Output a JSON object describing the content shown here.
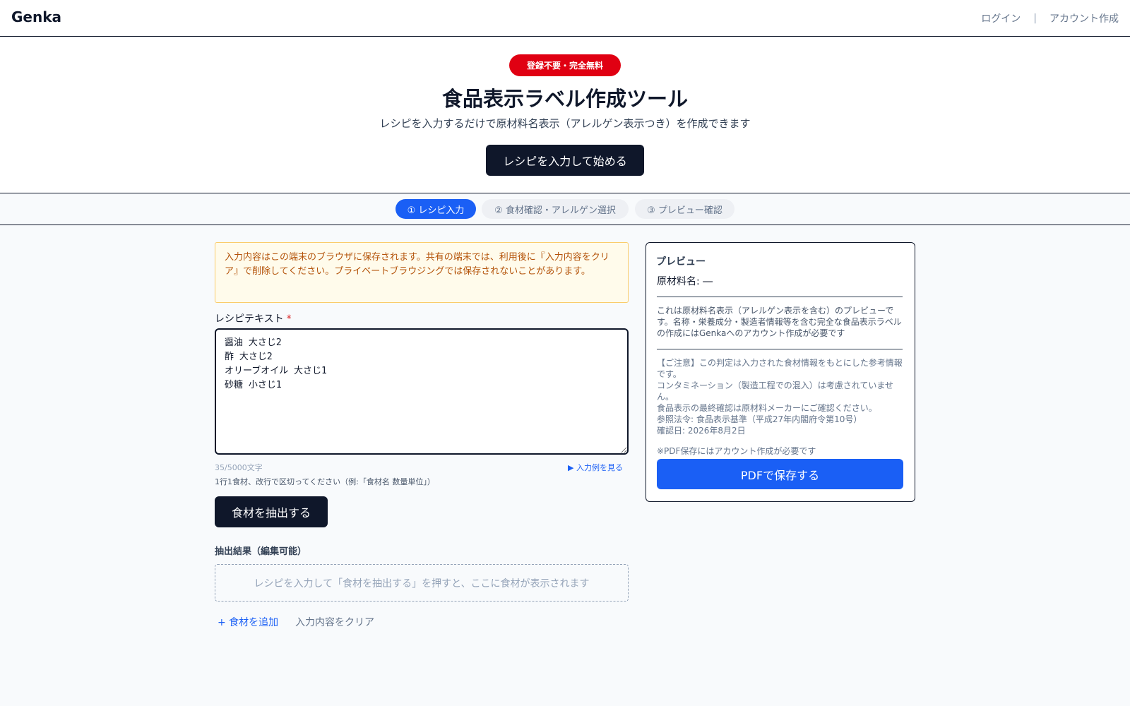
{
  "header": {
    "brand": "Genka",
    "login": "ログイン",
    "separator": "|",
    "signup": "アカウント作成"
  },
  "hero": {
    "badge": "登録不要・完全無料",
    "title": "食品表示ラベル作成ツール",
    "subtitle": "レシピを入力するだけで原材料名表示（アレルゲン表示つき）を作成できます",
    "cta": "レシピを入力して始める"
  },
  "steps": [
    {
      "label": "① レシピ入力",
      "active": true
    },
    {
      "label": "② 食材確認・アレルゲン選択",
      "active": false
    },
    {
      "label": "③ プレビュー確認",
      "active": false
    }
  ],
  "form": {
    "notice": "入力内容はこの端末のブラウザに保存されます。共有の端末では、利用後に『入力内容をクリア』で削除してください。プライベートブラウジングでは保存されないことがあります。",
    "recipe_label": "レシピテキスト",
    "required_mark": "*",
    "recipe_value": "醤油 大さじ2\n酢 大さじ2\nオリーブオイル 大さじ1\n砂糖 小さじ1",
    "char_count": "35/5000文字",
    "example_link": "▶ 入力例を見る",
    "hint": "1行1食材、改行で区切ってください（例:「食材名 数量単位」）",
    "extract_button": "食材を抽出する",
    "results_label": "抽出結果（編集可能）",
    "results_empty": "レシピを入力して「食材を抽出する」を押すと、ここに食材が表示されます",
    "add_ingredient": "+ 食材を追加",
    "clear_input": "入力内容をクリア"
  },
  "preview": {
    "title": "プレビュー",
    "ingredients_line": "原材料名: ―",
    "note": "これは原材料名表示（アレルゲン表示を含む）のプレビューです。名称・栄養成分・製造者情報等を含む完全な食品表示ラベルの作成にはGenkaへのアカウント作成が必要です",
    "caution_lines": [
      "【ご注意】この判定は入力された食材情報をもとにした参考情報です。",
      "コンタミネーション（製造工程での混入）は考慮されていません。",
      "食品表示の最終確認は原材料メーカーにご確認ください。",
      "参照法令: 食品表示基準（平成27年内閣府令第10号）",
      "確認日: 2026年8月2日"
    ],
    "pdf_note": "※PDF保存にはアカウント作成が必要です",
    "pdf_button": "PDFで保存する"
  },
  "colors": {
    "primary": "#1a5ff5",
    "dark": "#0f172a",
    "badge_red": "#e00012",
    "notice_bg": "#fffbeb",
    "notice_text": "#b45309"
  }
}
